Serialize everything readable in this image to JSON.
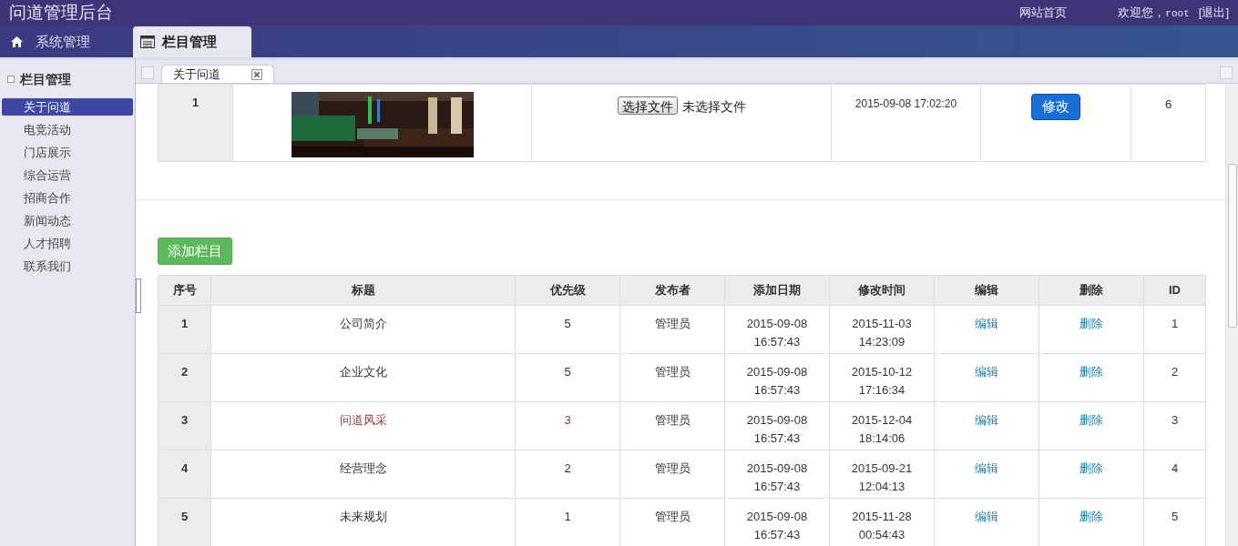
{
  "header": {
    "title": "问道管理后台",
    "home_link": "网站首页",
    "welcome": "欢迎您，",
    "user": "root",
    "logout": "[退出]"
  },
  "nav_tabs": [
    {
      "label": "系统管理",
      "kind": "home",
      "selected": false
    },
    {
      "label": "栏目管理",
      "kind": "list",
      "selected": true
    }
  ],
  "sidebar": {
    "title": "栏目管理",
    "items": [
      {
        "label": "关于问道",
        "selected": true
      },
      {
        "label": "电竞活动",
        "selected": false
      },
      {
        "label": "门店展示",
        "selected": false
      },
      {
        "label": "综合运营",
        "selected": false
      },
      {
        "label": "招商合作",
        "selected": false
      },
      {
        "label": "新闻动态",
        "selected": false
      },
      {
        "label": "人才招聘",
        "selected": false
      },
      {
        "label": "联系我们",
        "selected": false
      }
    ]
  },
  "page_tabs": [
    {
      "label": "关于问道",
      "selected": true
    }
  ],
  "banner_row": {
    "index": "1",
    "file_button": "选择文件",
    "file_status": "未选择文件",
    "time": "2015-09-08 17:02:20",
    "modify_button": "修改",
    "id": "6"
  },
  "add_button": "添加栏目",
  "table": {
    "columns": [
      "序号",
      "标题",
      "优先级",
      "发布者",
      "添加日期",
      "修改时间",
      "编辑",
      "删除",
      "ID"
    ],
    "rows": [
      {
        "index": "1",
        "title": "公司简介",
        "priority": "5",
        "author": "管理员",
        "added": [
          "2015-09-08",
          "16:57:43"
        ],
        "modified": [
          "2015-11-03",
          "14:23:09"
        ],
        "edit": "编辑",
        "delete": "删除",
        "id": "1",
        "highlighted": false
      },
      {
        "index": "2",
        "title": "企业文化",
        "priority": "5",
        "author": "管理员",
        "added": [
          "2015-09-08",
          "16:57:43"
        ],
        "modified": [
          "2015-10-12",
          "17:16:34"
        ],
        "edit": "编辑",
        "delete": "删除",
        "id": "2",
        "highlighted": false
      },
      {
        "index": "3",
        "title": "问道风采",
        "priority": "3",
        "author": "管理员",
        "added": [
          "2015-09-08",
          "16:57:43"
        ],
        "modified": [
          "2015-12-04",
          "18:14:06"
        ],
        "edit": "编辑",
        "delete": "删除",
        "id": "3",
        "highlighted": true
      },
      {
        "index": "4",
        "title": "经营理念",
        "priority": "2",
        "author": "管理员",
        "added": [
          "2015-09-08",
          "16:57:43"
        ],
        "modified": [
          "2015-09-21",
          "12:04:13"
        ],
        "edit": "编辑",
        "delete": "删除",
        "id": "4",
        "highlighted": false
      },
      {
        "index": "5",
        "title": "未来规划",
        "priority": "1",
        "author": "管理员",
        "added": [
          "2015-09-08",
          "16:57:43"
        ],
        "modified": [
          "2015-11-28",
          "00:54:43"
        ],
        "edit": "编辑",
        "delete": "删除",
        "id": "5",
        "highlighted": false
      }
    ]
  }
}
